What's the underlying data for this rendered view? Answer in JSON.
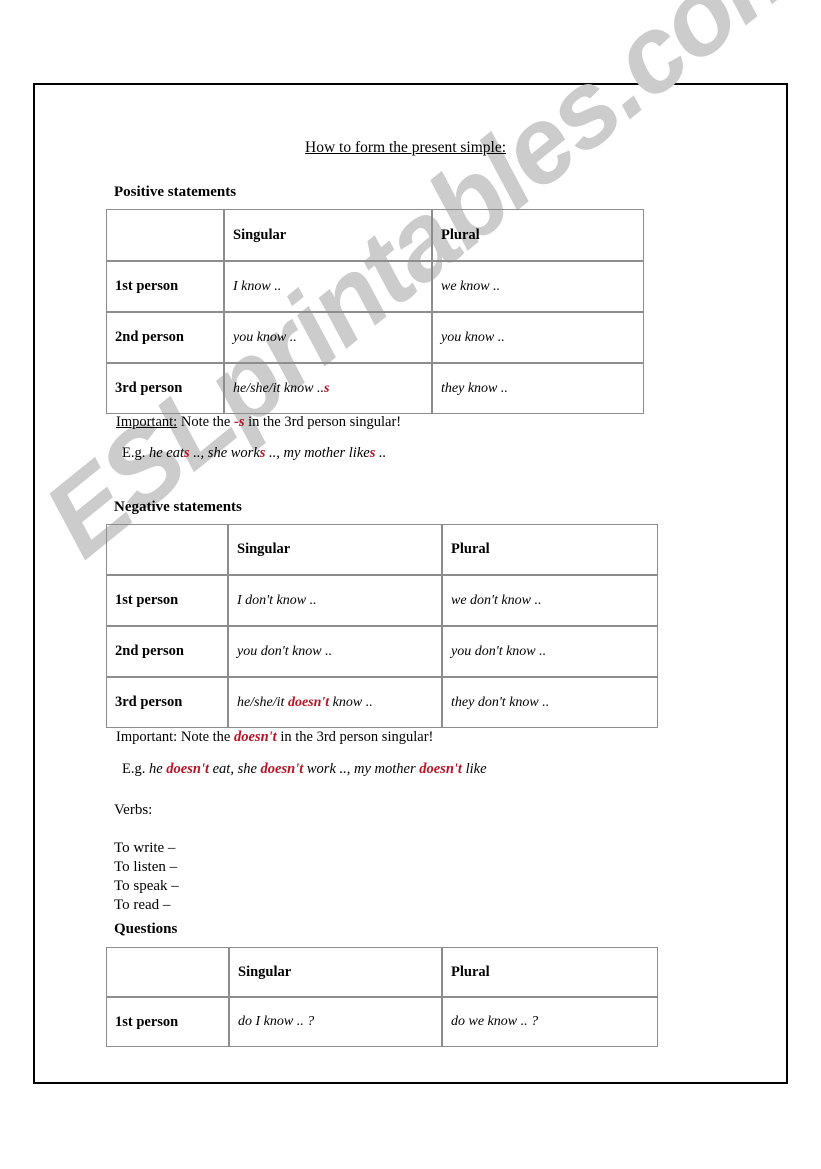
{
  "document": {
    "title": "How to form the present simple:",
    "watermark": "ESLprintables.com"
  },
  "sections": {
    "positive": {
      "heading": "Positive statements",
      "table": {
        "columns": [
          "",
          "Singular",
          "Plural"
        ],
        "rows": [
          {
            "person": "1st person",
            "singular_pre": "I know ..",
            "singular_red": "",
            "singular_post": "",
            "plural": "we know .."
          },
          {
            "person": "2nd person",
            "singular_pre": "you know ..",
            "singular_red": "",
            "singular_post": "",
            "plural": "you know .."
          },
          {
            "person": "3rd person",
            "singular_pre": "he/she/it know ..",
            "singular_red": "s",
            "singular_post": "",
            "plural": "they know .."
          }
        ]
      },
      "note": {
        "label": "Important:",
        "before": "  Note the ",
        "highlight": "-s",
        "after": " in the 3rd person singular!"
      },
      "example": {
        "label": "E.g.",
        "parts": [
          {
            "text": " he eat",
            "red": false
          },
          {
            "text": "s",
            "red": true
          },
          {
            "text": " .., she work",
            "red": false
          },
          {
            "text": "s",
            "red": true
          },
          {
            "text": " .., my mother like",
            "red": false
          },
          {
            "text": "s",
            "red": true
          },
          {
            "text": " ..",
            "red": false
          }
        ]
      }
    },
    "negative": {
      "heading": "Negative statements",
      "table": {
        "columns": [
          "",
          "Singular",
          "Plural"
        ],
        "rows": [
          {
            "person": "1st person",
            "singular_pre": "I don't know ..",
            "singular_red": "",
            "singular_post": "",
            "plural": "we don't know .."
          },
          {
            "person": "2nd person",
            "singular_pre": "you don't know ..",
            "singular_red": "",
            "singular_post": "",
            "plural": "you don't know .."
          },
          {
            "person": "3rd person",
            "singular_pre": "he/she/it ",
            "singular_red": "doesn't",
            "singular_post": " know ..",
            "plural": "they don't know .."
          }
        ]
      },
      "note": {
        "label": "Important:",
        "before": "  Note the ",
        "highlight": "doesn't",
        "after": " in the 3rd person singular!"
      },
      "example": {
        "label": "E.g.",
        "parts": [
          {
            "text": " he ",
            "red": false
          },
          {
            "text": "doesn't",
            "red": true
          },
          {
            "text": " eat, she ",
            "red": false
          },
          {
            "text": "doesn't",
            "red": true
          },
          {
            "text": " work .., my mother ",
            "red": false
          },
          {
            "text": "doesn't",
            "red": true
          },
          {
            "text": " like",
            "red": false
          }
        ]
      }
    },
    "verbs": {
      "label": "Verbs:",
      "items": [
        "To write –",
        "To listen –",
        "To speak –",
        "To read –"
      ]
    },
    "questions": {
      "heading": "Questions",
      "table": {
        "columns": [
          "",
          "Singular",
          "Plural"
        ],
        "rows": [
          {
            "person": "1st person",
            "singular_pre": "do I know .. ?",
            "singular_red": "",
            "singular_post": "",
            "plural": "do we know .. ?"
          }
        ]
      }
    }
  }
}
